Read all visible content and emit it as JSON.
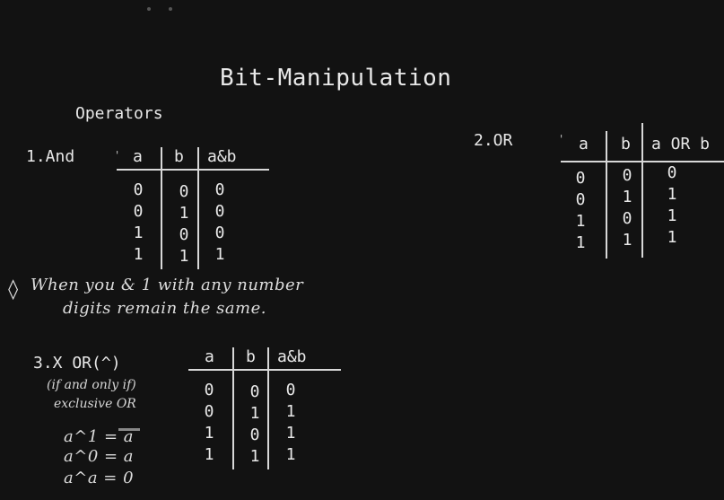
{
  "title": "Bit-Manipulation",
  "subtitle": "Operators",
  "and_section": {
    "label": "1.And",
    "headers": [
      "a",
      "b",
      "a&b"
    ],
    "rows": [
      [
        "0",
        "0",
        "0"
      ],
      [
        "0",
        "1",
        "0"
      ],
      [
        "1",
        "0",
        "0"
      ],
      [
        "1",
        "1",
        "1"
      ]
    ]
  },
  "or_section": {
    "label": "2.OR",
    "headers": [
      "a",
      "b",
      "a OR b"
    ],
    "rows": [
      [
        "0",
        "0",
        "0"
      ],
      [
        "0",
        "1",
        "1"
      ],
      [
        "1",
        "0",
        "1"
      ],
      [
        "1",
        "1",
        "1"
      ]
    ]
  },
  "note": {
    "bullet": "◊",
    "line1": "When you & 1 with any number",
    "line2": "digits remain the same."
  },
  "xor_section": {
    "label": "3.X OR(^)",
    "desc1": "(if and only if)",
    "desc2": "exclusive OR",
    "rules": [
      "a^1 = ā",
      "a^0 = a",
      "a^a = 0"
    ],
    "headers": [
      "a",
      "b",
      "a&b"
    ],
    "rows": [
      [
        "0",
        "0",
        "0"
      ],
      [
        "0",
        "1",
        "1"
      ],
      [
        "1",
        "0",
        "1"
      ],
      [
        "1",
        "1",
        "1"
      ]
    ]
  }
}
